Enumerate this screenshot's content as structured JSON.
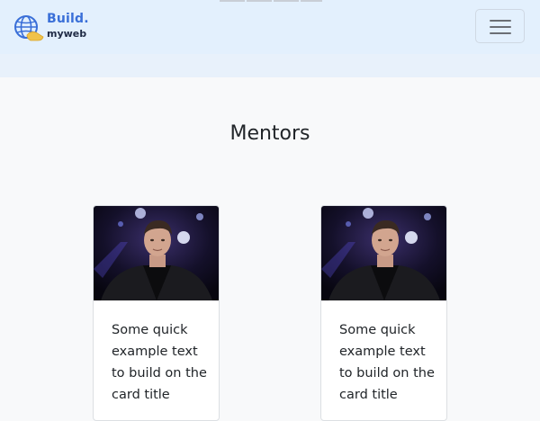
{
  "brand": {
    "line1": "Build.",
    "line2": "myweb",
    "icon": "globe-hand-icon"
  },
  "navbar": {
    "toggler_icon": "hamburger-menu-icon"
  },
  "section": {
    "title": "Mentors"
  },
  "cards": [
    {
      "image_icon": "mentor-photo",
      "text": "Some quick example text to build on the card title"
    },
    {
      "image_icon": "mentor-photo",
      "text": "Some quick example text to build on the card title"
    }
  ],
  "colors": {
    "navbar_bg": "#e3f0fd",
    "page_bg": "#f8f9fa",
    "brand_blue": "#3a6fd8",
    "text": "#212529"
  }
}
